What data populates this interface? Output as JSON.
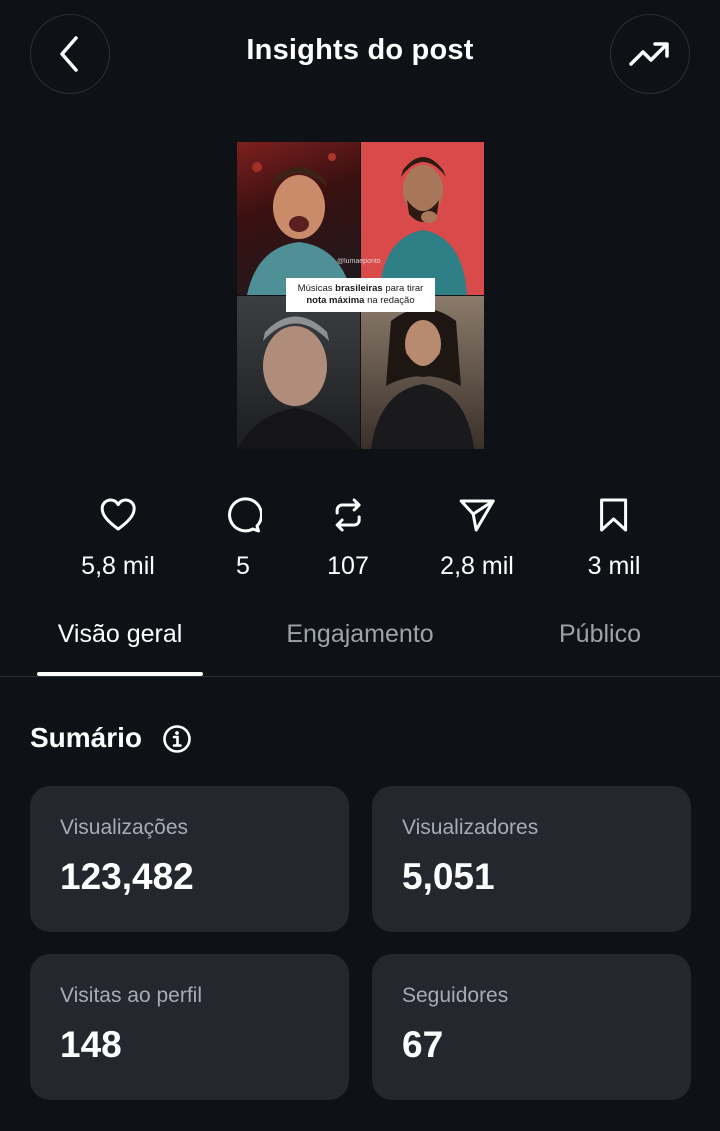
{
  "header": {
    "title": "Insights do post",
    "back_icon": "chevron-left-icon",
    "trend_icon": "trending-up-icon"
  },
  "post": {
    "handle": "@lumaeponto",
    "caption_line1_a": "Músicas ",
    "caption_line1_b": "brasileiras",
    "caption_line1_c": " para tirar",
    "caption_line2_a": "nota máxima",
    "caption_line2_b": " na redação"
  },
  "stats": [
    {
      "icon": "heart-icon",
      "value": "5,8 mil"
    },
    {
      "icon": "comment-icon",
      "value": "5"
    },
    {
      "icon": "repost-icon",
      "value": "107"
    },
    {
      "icon": "send-icon",
      "value": "2,8 mil"
    },
    {
      "icon": "bookmark-icon",
      "value": "3 mil"
    }
  ],
  "tabs": [
    {
      "label": "Visão geral",
      "active": true
    },
    {
      "label": "Engajamento",
      "active": false
    },
    {
      "label": "Público",
      "active": false
    }
  ],
  "summary": {
    "title": "Sumário",
    "info_icon": "info-icon",
    "cards": [
      {
        "label": "Visualizações",
        "value": "123,482"
      },
      {
        "label": "Visualizadores",
        "value": "5,051"
      },
      {
        "label": "Visitas ao perfil",
        "value": "148"
      },
      {
        "label": "Seguidores",
        "value": "67"
      }
    ]
  },
  "colors": {
    "background": "#0e1116",
    "card": "#24272d",
    "muted_text": "#9ea3ab"
  }
}
